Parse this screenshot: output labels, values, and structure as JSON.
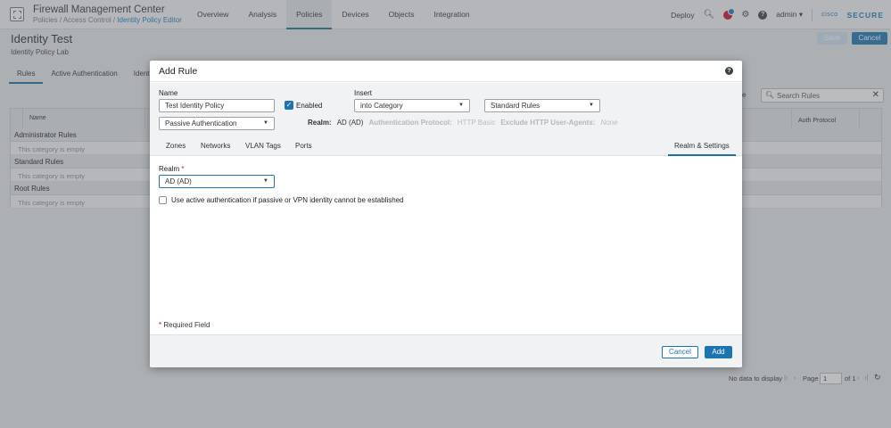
{
  "header": {
    "app_title": "Firewall Management Center",
    "breadcrumb": [
      "Policies",
      "Access Control",
      "Identity Policy Editor"
    ],
    "breadcrumb_sep": "/",
    "nav": [
      "Overview",
      "Analysis",
      "Policies",
      "Devices",
      "Objects",
      "Integration"
    ],
    "active_nav": "Policies",
    "deploy": "Deploy",
    "user": "admin",
    "user_caret": "▾",
    "brand_cisco": "cisco",
    "brand_secure": "SECURE",
    "icons": {
      "search": "search-icon",
      "alerts": "alert-icon",
      "settings": "gear-icon",
      "help": "help-icon"
    }
  },
  "page": {
    "title": "Identity Test",
    "subtitle": "Identity Policy Lab",
    "save": "Save",
    "cancel": "Cancel",
    "tabs": [
      "Rules",
      "Active Authentication",
      "Identi"
    ],
    "search_placeholder": "Search Rules",
    "partial_label": "e"
  },
  "table": {
    "columns": {
      "name": "Name",
      "auth": "Auth Protocol"
    },
    "categories": [
      {
        "name": "Administrator Rules",
        "empty": "This category is empty"
      },
      {
        "name": "Standard Rules",
        "empty": "This category is empty"
      },
      {
        "name": "Root Rules",
        "empty": "This category is empty"
      }
    ]
  },
  "pager": {
    "no_data": "No data to display",
    "page_label": "Page",
    "page_value": "1",
    "of_label": "of 1"
  },
  "modal": {
    "title": "Add Rule",
    "name_label": "Name",
    "name_value": "Test Identity Policy",
    "enabled_label": "Enabled",
    "insert_label": "Insert",
    "insert_value": "into Category",
    "category_value": "Standard Rules",
    "action_value": "Passive Authentication",
    "realm_key": "Realm:",
    "realm_val": "AD (AD)",
    "auth_proto_key": "Authentication Protocol:",
    "auth_proto_val": "HTTP Basic",
    "exclude_key": "Exclude HTTP User-Agents:",
    "exclude_val": "None",
    "tabs": [
      "Zones",
      "Networks",
      "VLAN Tags",
      "Ports",
      "Realm & Settings"
    ],
    "active_tab": "Realm & Settings",
    "realm_label": "Realm",
    "required_star": "*",
    "realm_select": "AD (AD)",
    "active_auth_label": "Use active authentication if passive or VPN identity cannot be established",
    "required_note": "Required Field",
    "cancel": "Cancel",
    "add": "Add"
  },
  "colors": {
    "accent": "#1d74b3",
    "required": "#c8102e"
  }
}
